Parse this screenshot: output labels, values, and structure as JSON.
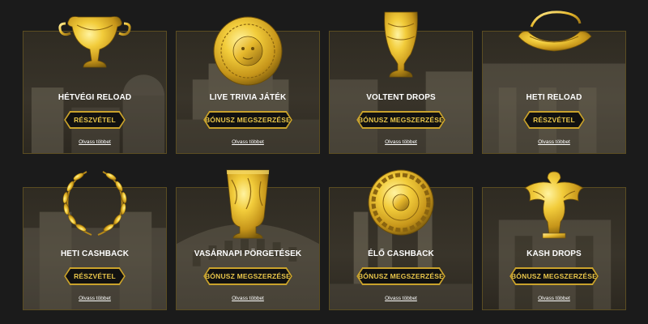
{
  "colors": {
    "page_bg": "#1b1b1b",
    "card_border": "#5b4d22",
    "gold": "#c9a22c",
    "button_text": "#e8c54a",
    "text": "#ffffff"
  },
  "cards": [
    {
      "title": "HÉTVÉGI RELOAD",
      "button": "RÉSZVÉTEL",
      "link": "Olvass többet",
      "icon": "golden-cup-icon"
    },
    {
      "title": "LIVE TRIVIA JÁTÉK",
      "button": "BÓNUSZ MEGSZERZÉSE",
      "link": "Olvass többet",
      "icon": "golden-medusa-shield-icon"
    },
    {
      "title": "VOLTENT DROPS",
      "button": "BÓNUSZ MEGSZERZÉSE",
      "link": "Olvass többet",
      "icon": "golden-goblet-icon"
    },
    {
      "title": "HETI RELOAD",
      "button": "RÉSZVÉTEL",
      "link": "Olvass többet",
      "icon": "golden-boat-vessel-icon"
    },
    {
      "title": "HETI CASHBACK",
      "button": "RÉSZVÉTEL",
      "link": "Olvass többet",
      "icon": "laurel-wreath-icon"
    },
    {
      "title": "VASÁRNAPI PÖRGETÉSEK",
      "button": "BÓNUSZ MEGSZERZÉSE",
      "link": "Olvass többet",
      "icon": "golden-beaker-icon"
    },
    {
      "title": "ÉLŐ CASHBACK",
      "button": "BÓNUSZ MEGSZERZÉSE",
      "link": "Olvass többet",
      "icon": "golden-plate-icon"
    },
    {
      "title": "KASH DROPS",
      "button": "BÓNUSZ MEGSZERZÉSE",
      "link": "Olvass többet",
      "icon": "golden-eagle-icon"
    }
  ]
}
